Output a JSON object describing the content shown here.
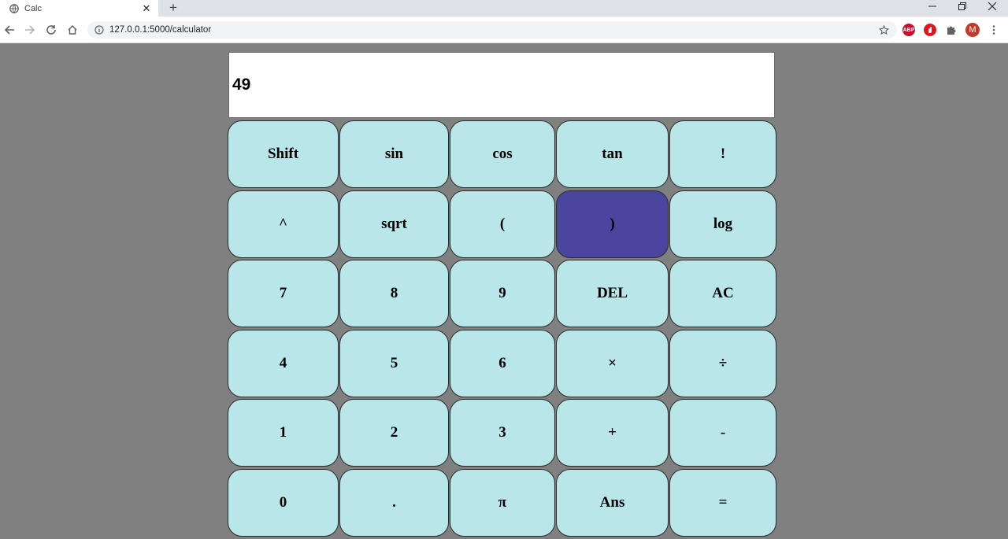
{
  "browser": {
    "tab_title": "Calc",
    "tab_close": "✕",
    "new_tab": "+",
    "url": "127.0.0.1:5000/calculator",
    "extensions": [
      {
        "icon": "adblock-plus-icon",
        "label": "ABP",
        "color": "#c70d2c"
      },
      {
        "icon": "adblock-icon",
        "label": "",
        "color": "#e3141e"
      },
      {
        "icon": "puzzle-extensions-icon",
        "label": "",
        "color": "#5f6368"
      }
    ],
    "profile_initial": "M",
    "profile_color": "#c5392a"
  },
  "calculator": {
    "display": "49",
    "colors": {
      "key": "#b9e6e8",
      "active_key": "#4a46a0",
      "background": "#808080"
    },
    "keys": [
      [
        "Shift",
        "sin",
        "cos",
        "tan",
        "!"
      ],
      [
        "^",
        "sqrt",
        "(",
        ")",
        "log"
      ],
      [
        "7",
        "8",
        "9",
        "DEL",
        "AC"
      ],
      [
        "4",
        "5",
        "6",
        "×",
        "÷"
      ],
      [
        "1",
        "2",
        "3",
        "+",
        "-"
      ],
      [
        "0",
        ".",
        "π",
        "Ans",
        "="
      ]
    ],
    "active_key": ")"
  }
}
